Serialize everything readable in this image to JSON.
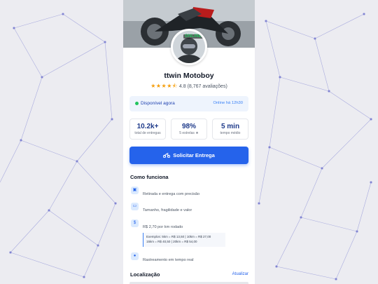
{
  "driver": {
    "name": "ttwin Motoboy",
    "rating": 4.8,
    "stars_display": "★★★★⯪",
    "rating_text": "4.8 (8,767 avaliações)",
    "avatar_badge": "ONLINE"
  },
  "status": {
    "label": "Disponível agora",
    "online_time": "Online há 12h30",
    "dot_color": "#22c55e"
  },
  "stats": [
    {
      "value": "10.2k+",
      "label": "total de entregas"
    },
    {
      "value": "98%",
      "label": "5 estrelas ★"
    },
    {
      "value": "5 min",
      "label": "tempo médio"
    }
  ],
  "cta": {
    "label": "Solicitar Entrega",
    "icon": "motorcycle-icon",
    "color": "#2563eb"
  },
  "how_it_works": {
    "title": "Como funciona",
    "steps": [
      {
        "icon": "box-icon",
        "text": "Retirada e entrega com precisão"
      },
      {
        "icon": "package-icon",
        "text": "Tamanho, fragilidade e valor"
      },
      {
        "icon": "money-icon",
        "text": "R$ 2,70 por km rodado"
      },
      {
        "icon": "location-icon",
        "text": "Rastreamento em tempo real"
      }
    ],
    "examples_line1": "Exemplos: 5km = R$ 13,50 | 10km = R$ 27,00",
    "examples_line2": "15km = R$ 40,50 | 20km = R$ 54,00"
  },
  "location": {
    "title": "Localização",
    "update_label": "Atualizar"
  },
  "colors": {
    "accent": "#2563eb",
    "page_bg": "#ececf1",
    "network_lines": "#8c8fd6"
  }
}
